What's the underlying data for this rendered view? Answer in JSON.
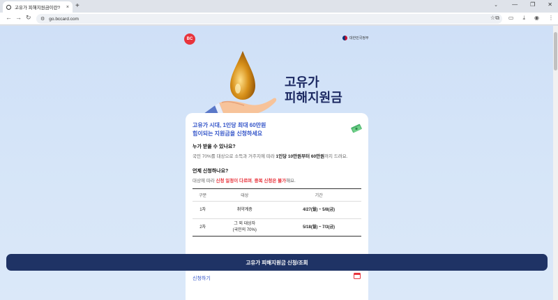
{
  "browser": {
    "tab_title": "고유가 피해지원금이란?",
    "tab_close": "×",
    "new_tab": "+",
    "url": "go.bccard.com"
  },
  "page": {
    "gov_label": "대한민국정부",
    "heading_line1": "고유가",
    "heading_line2": "피해지원금",
    "intro_line1": "고유가 시대, 1인당 최대 60만원",
    "intro_line2": "힘이되는 지원금을 신청하세요",
    "q_who": "누가 받을 수 있나요?",
    "a_who_pre": "국민 70%를 대상으로 소득과 거주지에 따라 ",
    "a_who_bold": "1인당 10만원부터 60만원",
    "a_who_post": "까지 드려요.",
    "q_when": "언제 신청하나요?",
    "a_when_pre": "대상에 따라 ",
    "a_when_red1": "신청 일정이 다르며",
    "a_when_mid": ", ",
    "a_when_red2": "중복 신청은 불가",
    "a_when_post": "해요.",
    "table": {
      "headers": [
        "구분",
        "대상",
        "기간"
      ],
      "rows": [
        {
          "round": "1차",
          "target": "취약계층",
          "target2": "",
          "period": "4/27(월) ~ 5/8(금)"
        },
        {
          "round": "2차",
          "target": "그 외 대상자",
          "target2": "(국민의 70%)",
          "period": "5/18(월) ~ 7/3(금)"
        }
      ]
    },
    "card2_label": "신청하기",
    "cta_label": "고유가 피해지원금 신청/조회"
  },
  "colors": {
    "brand_red": "#e8343c",
    "heading_navy": "#1d2a63",
    "cta_navy": "#1f3365",
    "accent_blue": "#3455c9"
  },
  "icons": [
    "favicon",
    "back-icon",
    "forward-icon",
    "reload-icon",
    "site-info-icon",
    "star-icon",
    "extensions-icon",
    "cast-icon",
    "profile-icon",
    "menu-icon",
    "money-icon"
  ]
}
